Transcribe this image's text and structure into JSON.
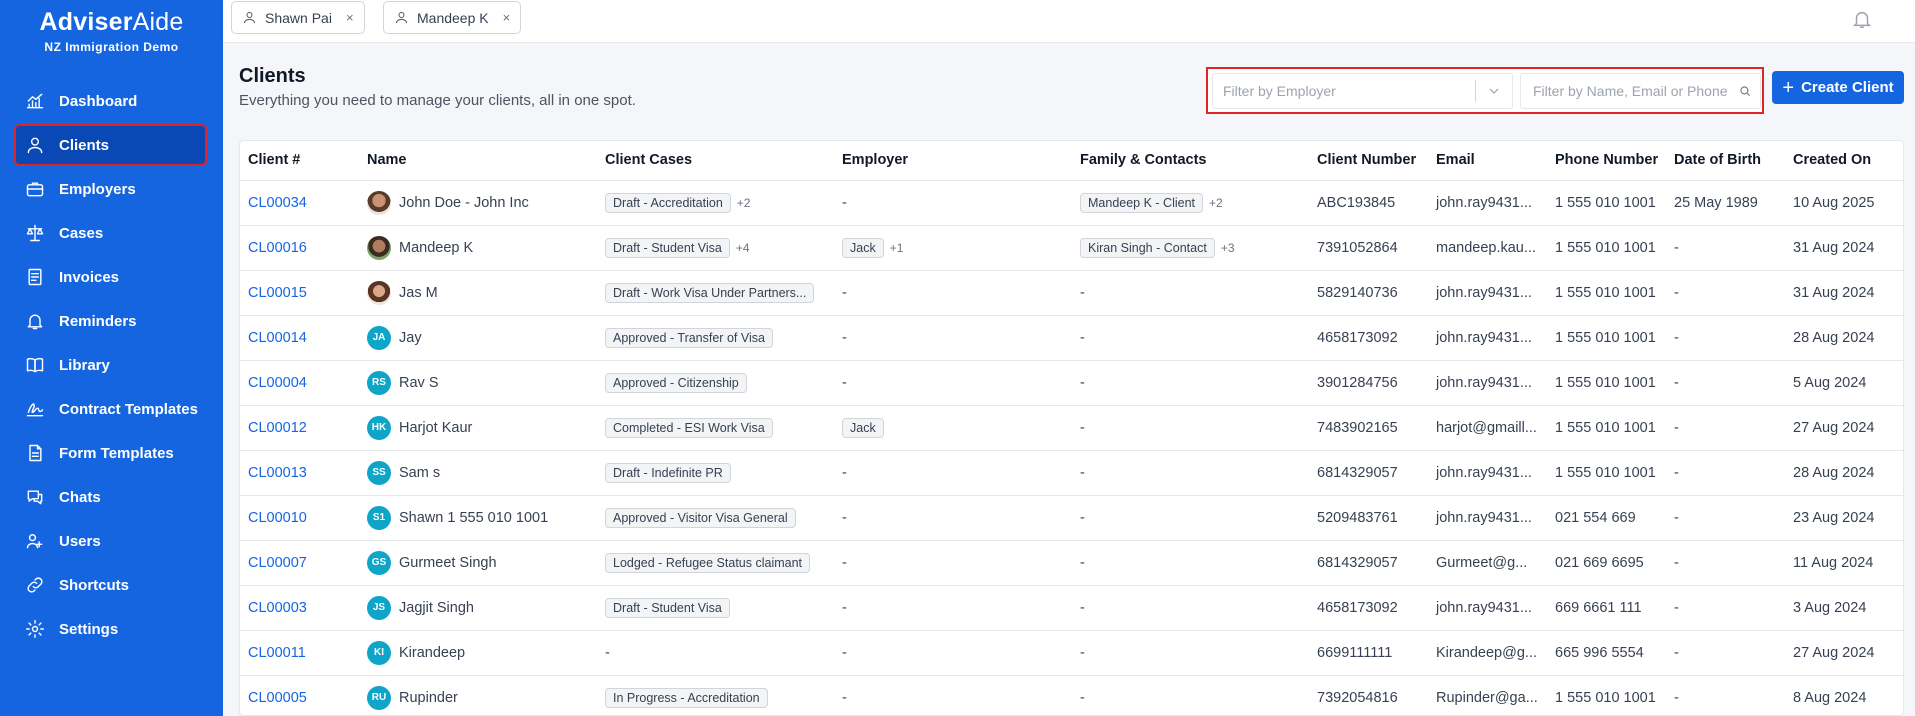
{
  "brand": {
    "title_bold": "Adviser",
    "title_light": "Aide",
    "subtitle": "NZ Immigration Demo"
  },
  "sidebar": {
    "items": [
      {
        "label": "Dashboard",
        "icon": "chart-icon"
      },
      {
        "label": "Clients",
        "icon": "user-icon",
        "active": true
      },
      {
        "label": "Employers",
        "icon": "briefcase-icon"
      },
      {
        "label": "Cases",
        "icon": "scale-icon"
      },
      {
        "label": "Invoices",
        "icon": "invoice-icon"
      },
      {
        "label": "Reminders",
        "icon": "bell-icon"
      },
      {
        "label": "Library",
        "icon": "book-icon"
      },
      {
        "label": "Contract Templates",
        "icon": "signature-icon"
      },
      {
        "label": "Form Templates",
        "icon": "form-icon"
      },
      {
        "label": "Chats",
        "icon": "chat-icon"
      },
      {
        "label": "Users",
        "icon": "users-icon"
      },
      {
        "label": "Shortcuts",
        "icon": "link-icon"
      },
      {
        "label": "Settings",
        "icon": "gear-icon"
      }
    ]
  },
  "tabs": [
    {
      "label": "Shawn Pai",
      "close": "×"
    },
    {
      "label": "Mandeep K",
      "close": "×"
    }
  ],
  "header": {
    "title": "Clients",
    "subtitle": "Everything you need to manage your clients, all in one spot."
  },
  "filters": {
    "employer_placeholder": "Filter by Employer",
    "search_placeholder": "Filter by Name, Email or Phone"
  },
  "create_button": {
    "plus": "+",
    "label": "Create Client"
  },
  "table": {
    "columns": [
      "Client #",
      "Name",
      "Client Cases",
      "Employer",
      "Family & Contacts",
      "Client Number",
      "Email",
      "Phone Number",
      "Date of Birth",
      "Created On"
    ],
    "rows": [
      {
        "id": "CL00034",
        "avatar": "photo1",
        "initials": "",
        "name": "John Doe - John Inc",
        "case": "Draft - Accreditation",
        "case_more": "+2",
        "employer": "-",
        "employer_more": "",
        "family": "Mandeep K - Client",
        "family_more": "+2",
        "client_number": "ABC193845",
        "email": "john.ray9431...",
        "phone": "1 555 010 1001",
        "dob": "25 May 1989",
        "created": "10 Aug 2025"
      },
      {
        "id": "CL00016",
        "avatar": "photo2",
        "initials": "",
        "name": "Mandeep K",
        "case": "Draft - Student Visa",
        "case_more": "+4",
        "employer": "Jack",
        "employer_more": "+1",
        "family": "Kiran Singh - Contact",
        "family_more": "+3",
        "client_number": "7391052864",
        "email": "mandeep.kau...",
        "phone": "1 555 010 1001",
        "dob": "-",
        "created": "31 Aug 2024"
      },
      {
        "id": "CL00015",
        "avatar": "photo3",
        "initials": "",
        "name": "Jas M",
        "case": "Draft - Work Visa Under Partners...",
        "case_more": "",
        "employer": "-",
        "employer_more": "",
        "family": "-",
        "family_more": "",
        "client_number": "5829140736",
        "email": "john.ray9431...",
        "phone": "1 555 010 1001",
        "dob": "-",
        "created": "31 Aug 2024"
      },
      {
        "id": "CL00014",
        "avatar": "init",
        "initials": "JA",
        "name": "Jay",
        "case": "Approved - Transfer of Visa",
        "case_more": "",
        "employer": "-",
        "employer_more": "",
        "family": "-",
        "family_more": "",
        "client_number": "4658173092",
        "email": "john.ray9431...",
        "phone": "1 555 010 1001",
        "dob": "-",
        "created": "28 Aug 2024"
      },
      {
        "id": "CL00004",
        "avatar": "init",
        "initials": "RS",
        "name": "Rav S",
        "case": "Approved - Citizenship",
        "case_more": "",
        "employer": "-",
        "employer_more": "",
        "family": "-",
        "family_more": "",
        "client_number": "3901284756",
        "email": "john.ray9431...",
        "phone": "1 555 010 1001",
        "dob": "-",
        "created": "5 Aug 2024"
      },
      {
        "id": "CL00012",
        "avatar": "init",
        "initials": "HK",
        "name": "Harjot Kaur",
        "case": "Completed - ESI Work Visa",
        "case_more": "",
        "employer": "Jack",
        "employer_more": "",
        "family": "-",
        "family_more": "",
        "client_number": "7483902165",
        "email": "harjot@gmaill...",
        "phone": "1 555 010 1001",
        "dob": "-",
        "created": "27 Aug 2024"
      },
      {
        "id": "CL00013",
        "avatar": "init",
        "initials": "SS",
        "name": "Sam s",
        "case": "Draft - Indefinite PR",
        "case_more": "",
        "employer": "-",
        "employer_more": "",
        "family": "-",
        "family_more": "",
        "client_number": "6814329057",
        "email": "john.ray9431...",
        "phone": "1 555 010 1001",
        "dob": "-",
        "created": "28 Aug 2024"
      },
      {
        "id": "CL00010",
        "avatar": "init",
        "initials": "S1",
        "name": "Shawn 1 555 010 1001",
        "case": "Approved - Visitor Visa General",
        "case_more": "",
        "employer": "-",
        "employer_more": "",
        "family": "-",
        "family_more": "",
        "client_number": "5209483761",
        "email": "john.ray9431...",
        "phone": "021 554 669",
        "dob": "-",
        "created": "23 Aug 2024"
      },
      {
        "id": "CL00007",
        "avatar": "init",
        "initials": "GS",
        "name": "Gurmeet Singh",
        "case": "Lodged - Refugee Status claimant",
        "case_more": "",
        "employer": "-",
        "employer_more": "",
        "family": "-",
        "family_more": "",
        "client_number": "6814329057",
        "email": "Gurmeet@g...",
        "phone": "021 669 6695",
        "dob": "-",
        "created": "11 Aug 2024"
      },
      {
        "id": "CL00003",
        "avatar": "init",
        "initials": "JS",
        "name": "Jagjit Singh",
        "case": "Draft - Student Visa",
        "case_more": "",
        "employer": "-",
        "employer_more": "",
        "family": "-",
        "family_more": "",
        "client_number": "4658173092",
        "email": "john.ray9431...",
        "phone": "669 6661 111",
        "dob": "-",
        "created": "3 Aug 2024"
      },
      {
        "id": "CL00011",
        "avatar": "init",
        "initials": "KI",
        "name": "Kirandeep",
        "case": "-",
        "case_more": "",
        "employer": "-",
        "employer_more": "",
        "family": "-",
        "family_more": "",
        "client_number": "6699111111",
        "email": "Kirandeep@g...",
        "phone": "665 996 5554",
        "dob": "-",
        "created": "27 Aug 2024"
      },
      {
        "id": "CL00005",
        "avatar": "init",
        "initials": "RU",
        "name": "Rupinder",
        "case": "In Progress - Accreditation",
        "case_more": "",
        "employer": "-",
        "employer_more": "",
        "family": "-",
        "family_more": "",
        "client_number": "7392054816",
        "email": "Rupinder@ga...",
        "phone": "1 555 010 1001",
        "dob": "-",
        "created": "8 Aug 2024"
      }
    ]
  },
  "colors": {
    "primary": "#1565e0",
    "active_nav": "#0a48b5",
    "highlight": "#e02424",
    "avatar": "#0ea5c9"
  }
}
